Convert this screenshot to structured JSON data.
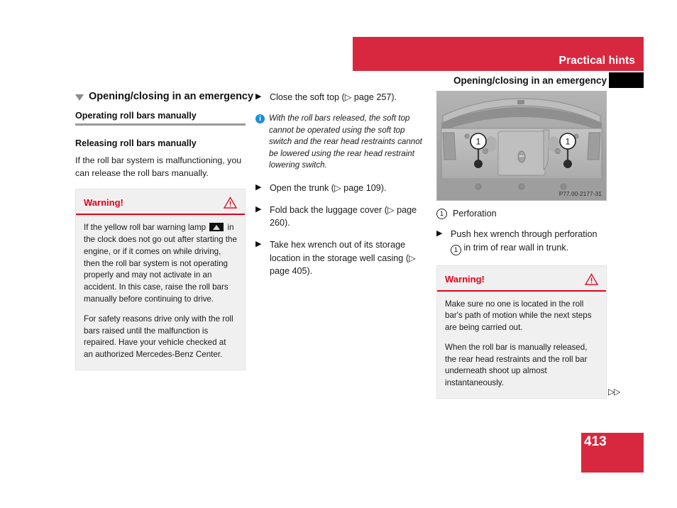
{
  "header": {
    "banner_title": "Practical hints",
    "running_head": "Opening/closing in an emergency"
  },
  "left_column": {
    "section_title": "Opening/closing in an emergency",
    "subsection_title": "Operating roll bars manually",
    "heading": "Releasing roll bars manually",
    "paragraph": "If the roll bar system is malfunctioning, you can release the roll bars manually.",
    "warning": {
      "title": "Warning!",
      "text_before_lamp": "If the yellow roll bar warning lamp",
      "text_after_lamp": "in the clock does not go out after starting the engine, or if it comes on while driving, then the roll bar system is not operating properly and may not activate in an accident. In this case, raise the roll bars manually before continuing to drive.",
      "paragraph2": "For safety reasons drive only with the roll bars raised until the malfunction is repaired. Have your vehicle checked at an authorized Mercedes-Benz Center."
    }
  },
  "middle_column": {
    "steps": [
      "Close the soft top (▷ page 257).",
      "Open the trunk (▷ page 109).",
      "Fold back the luggage cover (▷ page 260).",
      "Take hex wrench out of its storage location in the storage well casing (▷ page 405)."
    ],
    "note": "With the roll bars released, the soft top cannot be operated using the soft top switch and the rear head restraints cannot be lowered using the rear head restraint lowering switch."
  },
  "right_column": {
    "figure_code": "P77.00-2177-31",
    "figure_callouts": [
      "1",
      "1"
    ],
    "legend_number": "1",
    "legend_label": "Perforation",
    "step_before_ref": "Push hex wrench through perforation",
    "step_ref_number": "1",
    "step_after_ref": "in trim of rear wall in trunk.",
    "warning": {
      "title": "Warning!",
      "paragraph1": "Make sure no one is located in the roll bar's path of motion while the next steps are being carried out.",
      "paragraph2": "When the roll bar is manually released, the rear head restraints and the roll bar underneath shoot up almost instantaneously."
    }
  },
  "footer": {
    "continuation": "▷▷",
    "page_number": "413"
  },
  "colors": {
    "accent_red": "#d8283f",
    "warning_red": "#e3001b",
    "info_blue": "#1a8fd8",
    "box_gray": "#f0f0f0"
  }
}
